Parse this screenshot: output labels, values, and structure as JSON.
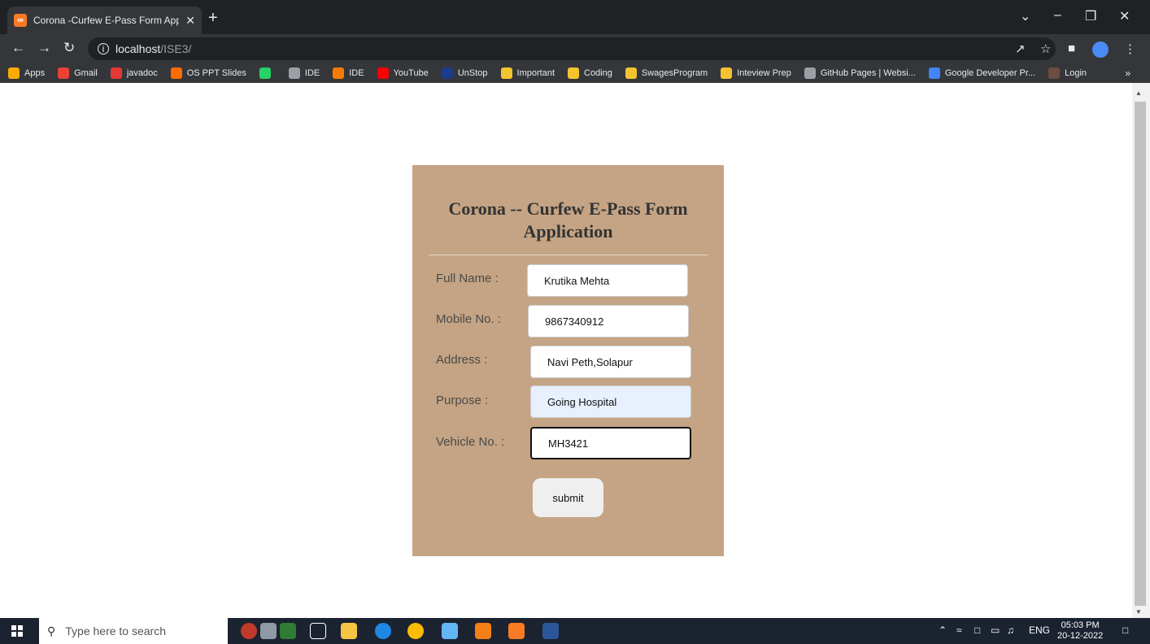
{
  "browser": {
    "tab_title": "Corona -Curfew E-Pass Form Applic",
    "tab_favicon": "XAMPP",
    "url_host": "localhost",
    "url_path": "/ISE3/"
  },
  "bookmarks": [
    {
      "label": "Apps",
      "icon": "apps-grid-icon",
      "color": "#f9ab00"
    },
    {
      "label": "Gmail",
      "icon": "gmail-icon",
      "color": "#ea4335"
    },
    {
      "label": "javadoc",
      "icon": "oracle-icon",
      "color": "#e53935"
    },
    {
      "label": "OS PPT Slides",
      "icon": "blogger-icon",
      "color": "#ff6d00"
    },
    {
      "label": "",
      "icon": "whatsapp-icon",
      "color": "#25d366"
    },
    {
      "label": "IDE",
      "icon": "globe-icon",
      "color": "#9aa0a6"
    },
    {
      "label": "IDE",
      "icon": "code-icon",
      "color": "#f57c00"
    },
    {
      "label": "YouTube",
      "icon": "youtube-icon",
      "color": "#ff0000"
    },
    {
      "label": "UnStop",
      "icon": "unstop-icon",
      "color": "#1d3b8a"
    },
    {
      "label": "Important",
      "icon": "folder-icon",
      "color": "#f4c430"
    },
    {
      "label": "Coding",
      "icon": "folder-icon",
      "color": "#f4c430"
    },
    {
      "label": "SwagesProgram",
      "icon": "folder-icon",
      "color": "#f4c430"
    },
    {
      "label": "Inteview Prep",
      "icon": "folder-icon",
      "color": "#f4c430"
    },
    {
      "label": "GitHub Pages | Websi...",
      "icon": "github-icon",
      "color": "#9aa0a6"
    },
    {
      "label": "Google Developer Pr...",
      "icon": "google-dev-icon",
      "color": "#4285f4"
    },
    {
      "label": "Login",
      "icon": "login-icon",
      "color": "#6d4c41"
    }
  ],
  "form": {
    "title": "Corona -- Curfew E-Pass Form Application",
    "fields": [
      {
        "label": "Full Name :",
        "value": "Krutika Mehta"
      },
      {
        "label": "Mobile No. :",
        "value": "9867340912"
      },
      {
        "label": "Address :",
        "value": "Navi Peth,Solapur"
      },
      {
        "label": "Purpose :",
        "value": "Going Hospital"
      },
      {
        "label": "Vehicle No. :",
        "value": "MH3421"
      }
    ],
    "submit_label": "submit",
    "card_color": "#c4a484"
  },
  "taskbar": {
    "search_placeholder": "Type here to search",
    "language": "ENG",
    "time": "05:03 PM",
    "date": "20-12-2022"
  }
}
